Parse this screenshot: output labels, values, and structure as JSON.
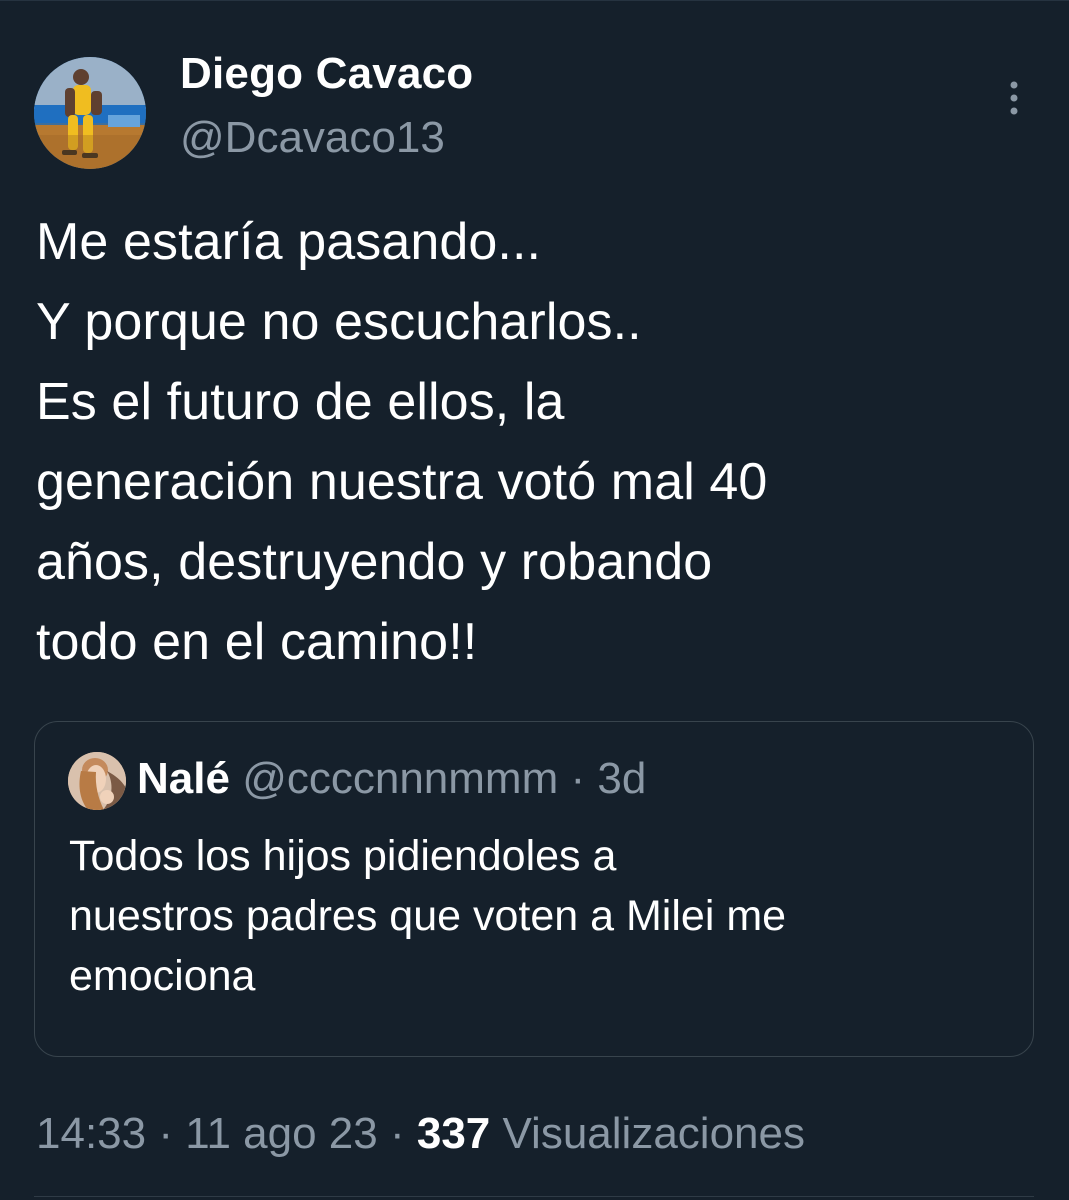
{
  "tweet": {
    "author": {
      "display_name": "Diego Cavaco",
      "handle": "@Dcavaco13",
      "avatar_icon": "avatar-photo-icon"
    },
    "more_icon": "more-options-icon",
    "text_lines": [
      "Me estaría pasando...",
      "Y porque no escucharlos..",
      "Es el futuro de ellos, la",
      "generación nuestra votó mal 40",
      "años, destruyendo y robando",
      "todo en el camino!!"
    ],
    "quoted_tweet": {
      "display_name": "Nalé",
      "handle": "@ccccnnnmmm",
      "separator": "·",
      "time": "3d",
      "text_lines": [
        "Todos los hijos pidiendoles a",
        "nuestros padres que voten a Milei me",
        "emociona"
      ],
      "avatar_icon": "quoted-avatar-photo-icon"
    },
    "meta": {
      "time": "14:33",
      "separator_1": "·",
      "date": "11 ago 23",
      "separator_2": "·",
      "views_count": "337",
      "views_label": "Visualizaciones"
    }
  },
  "theme": {
    "background": "#15202b",
    "primary_text": "#ffffff",
    "secondary_text": "#8b98a5",
    "border": "#38444d"
  }
}
